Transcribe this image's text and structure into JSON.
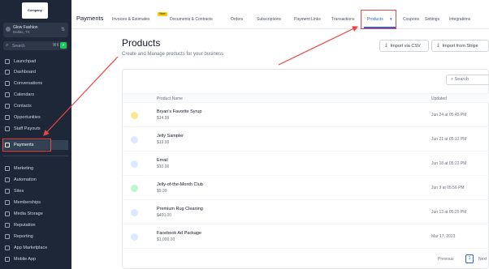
{
  "sidebar": {
    "logo": "Company",
    "account_name": "Glow Fashion",
    "account_sub": "Dallas, TX",
    "search_placeholder": "Search",
    "search_shortcut": "⌘K",
    "items_top": [
      "Launchpad",
      "Dashboard",
      "Conversations",
      "Calendars",
      "Contacts",
      "Opportunities",
      "Staff Payouts",
      "Payments"
    ],
    "items_bottom": [
      "Marketing",
      "Automation",
      "Sites",
      "Memberships",
      "Media Storage",
      "Reputation",
      "Reporting",
      "App Marketplace",
      "Mobile App"
    ],
    "active_item": "Payments"
  },
  "topnav": {
    "title": "Payments",
    "tabs": [
      "Invoices & Estimates",
      "Documents & Contracts",
      "Orders",
      "Subscriptions",
      "Payment Links",
      "Transactions",
      "Products",
      "Coupons",
      "Settings",
      "Integrations"
    ],
    "new_badge": "New",
    "active_tab": "Products"
  },
  "main": {
    "title": "Products",
    "subtitle": "Create and Manage products for your business",
    "import_csv_label": "Import via CSV",
    "import_stripe_label": "Import from Stripe",
    "table_search_placeholder": "Search",
    "columns": [
      "Product Name",
      "Updated"
    ],
    "rows": [
      {
        "name": "Bryan's Favorite Syrup",
        "price": "$14.99",
        "updated": "Jun 24 at 05:45 PM"
      },
      {
        "name": "Jelly Sampler",
        "price": "$19.99",
        "updated": "Jun 21 at 05:13 PM"
      },
      {
        "name": "Email",
        "price": "$10.00",
        "updated": "Jun 18 at 05:22 PM"
      },
      {
        "name": "Jelly-of-the-Month Club",
        "price": "$9.99",
        "updated": "Jun 9 at 05:56 PM"
      },
      {
        "name": "Premium Rug Cleaning",
        "price": "$400.00",
        "updated": "Jun 13 at 05:25 PM"
      },
      {
        "name": "Facebook Ad Package",
        "price": "$1,000.00",
        "updated": "Mar 17, 2023"
      }
    ],
    "pager_prev": "Previous",
    "pager_current": "1",
    "pager_next": "Next"
  },
  "colors": {
    "sidebar_bg": "#1e2738",
    "accent": "#2563eb",
    "annotation_red": "#ef4444"
  }
}
